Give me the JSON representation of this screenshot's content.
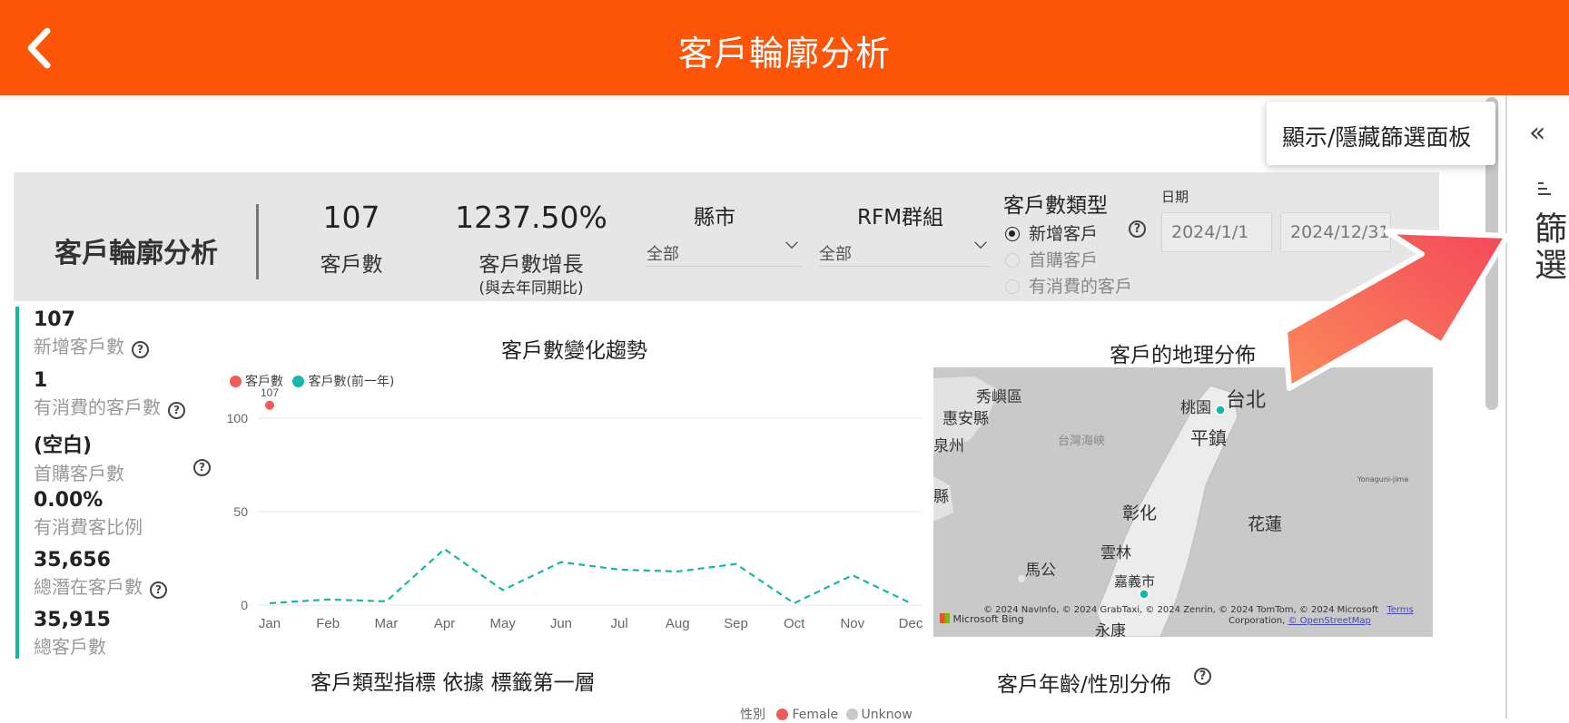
{
  "app": {
    "title": "客戶輪廓分析",
    "back_icon": "chevron-left-icon",
    "accent": "#fc5507"
  },
  "filter_panel": {
    "tooltip": "顯示/隱藏篩選面板",
    "label": "篩選"
  },
  "header_band": {
    "title": "客戶輪廓分析",
    "kpis": [
      {
        "value": "107",
        "label": "客戶數"
      },
      {
        "value": "1237.50%",
        "label": "客戶數增長",
        "sub": "(與去年同期比)"
      }
    ],
    "slicers": {
      "county": {
        "title": "縣市",
        "value": "全部"
      },
      "rfm": {
        "title": "RFM群組",
        "value": "全部"
      }
    },
    "customer_type": {
      "title": "客戶數類型",
      "options": [
        "新增客戶",
        "首購客戶",
        "有消費的客戶"
      ],
      "selected": "新增客戶"
    },
    "date": {
      "title": "日期",
      "start": "2024/1/1",
      "end": "2024/12/31"
    }
  },
  "metrics": [
    {
      "value": "107",
      "label": "新增客戶數",
      "help": true
    },
    {
      "value": "1",
      "label": "有消費的客戶數",
      "help": true
    },
    {
      "value": "(空白)",
      "label": "首購客戶數",
      "help": true
    },
    {
      "value": "0.00%",
      "label": "有消費客比例",
      "help": false
    },
    {
      "value": "35,656",
      "label": "總潛在客戶數",
      "help": true
    },
    {
      "value": "35,915",
      "label": "總客戶數",
      "help": false
    }
  ],
  "trend_chart": {
    "title": "客戶數變化趨勢",
    "legend": [
      "客戶數",
      "客戶數(前一年)"
    ]
  },
  "chart_data": {
    "type": "line",
    "title": "客戶數變化趨勢",
    "x": [
      "Jan",
      "Feb",
      "Mar",
      "Apr",
      "May",
      "Jun",
      "Jul",
      "Aug",
      "Sep",
      "Oct",
      "Nov",
      "Dec"
    ],
    "yticks": [
      0,
      50,
      100
    ],
    "ylim": [
      0,
      120
    ],
    "grid": true,
    "legend_position": "top-left",
    "series": [
      {
        "name": "客戶數",
        "color": "#f05a5a",
        "style": "point",
        "values": [
          107,
          null,
          null,
          null,
          null,
          null,
          null,
          null,
          null,
          null,
          null,
          null
        ],
        "data_labels": [
          "107"
        ]
      },
      {
        "name": "客戶數(前一年)",
        "color": "#14b8a6",
        "style": "dashed",
        "values": [
          1,
          3,
          2,
          30,
          8,
          23,
          19,
          18,
          22,
          1,
          16,
          1
        ]
      }
    ]
  },
  "map": {
    "title": "客戶的地理分佈",
    "labels": [
      "秀嶼區",
      "惠安縣",
      "泉州",
      "台灣海峽",
      "台北",
      "桃園",
      "平鎮",
      "彰化",
      "花蓮",
      "縣",
      "馬公",
      "雲林",
      "嘉義市",
      "永康",
      "Yonaguni-jima"
    ],
    "attribution": "© 2024 NavInfo, © 2024 GrabTaxi, © 2024 Zenrin, © 2024 TomTom, © 2024 Microsoft",
    "attribution_2": "Corporation,",
    "terms": "Terms",
    "osm": "© OpenStreetMap",
    "provider": "Microsoft Bing"
  },
  "bottom": {
    "left_title": "客戶類型指標 依據 標籤第一層",
    "right_title": "客戶年齡/性別分佈",
    "gender_legend": {
      "label": "性別",
      "items": [
        "Female",
        "Unknow"
      ]
    }
  }
}
